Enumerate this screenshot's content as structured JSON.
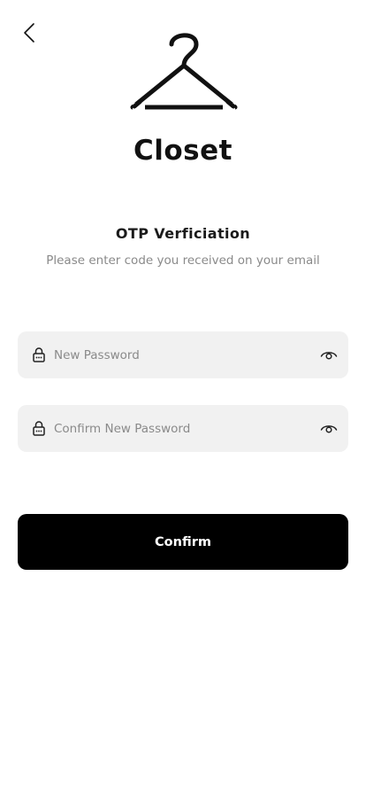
{
  "colors": {
    "background": "#ffffff",
    "field_background": "#f1f1f1",
    "button_background": "#000000",
    "button_text": "#ffffff",
    "muted_text": "#8a8a8a"
  },
  "header": {
    "back_icon": "chevron-left-icon",
    "logo_icon": "hanger-icon",
    "brand_name": "Closet"
  },
  "main": {
    "title": "OTP Verficiation",
    "subtitle": "Please enter code you received on your email"
  },
  "form": {
    "new_password": {
      "placeholder": "New Password",
      "value": "",
      "leading_icon": "lock-icon",
      "trailing_icon": "eye-icon"
    },
    "confirm_password": {
      "placeholder": "Confirm New Password",
      "value": "",
      "leading_icon": "lock-icon",
      "trailing_icon": "eye-icon"
    },
    "submit_label": "Confirm"
  }
}
